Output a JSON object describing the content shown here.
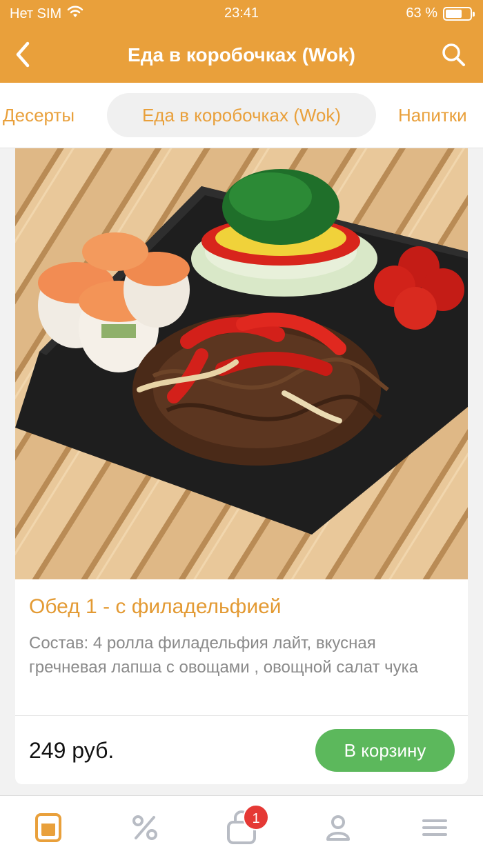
{
  "status": {
    "carrier": "Нет SIM",
    "time": "23:41",
    "battery": "63 %",
    "battery_level_percent": 63
  },
  "header": {
    "title": "Еда в коробочках (Wok)",
    "back_icon": "chevron-left-icon",
    "search_icon": "search-icon"
  },
  "categories": [
    {
      "label": "Десерты",
      "selected": false
    },
    {
      "label": "Еда в коробочках (Wok)",
      "selected": true
    },
    {
      "label": "Напитки",
      "selected": false
    }
  ],
  "product": {
    "title": "Обед 1 - с филадельфией",
    "description": "Состав: 4 ролла филадельфия лайт, вкусная гречневая лапша с овощами , овощной салат чука",
    "price": "249 руб.",
    "cart_button": "В корзину"
  },
  "tabbar": {
    "items": [
      "menu-icon",
      "discount-icon",
      "cart-icon",
      "profile-icon",
      "hamburger-icon"
    ],
    "active": "menu-icon",
    "cart_badge": "1"
  },
  "colors": {
    "accent": "#e9a03b",
    "title_orange": "#e39a33",
    "button_green": "#5cb85c",
    "badge_red": "#e53935"
  }
}
